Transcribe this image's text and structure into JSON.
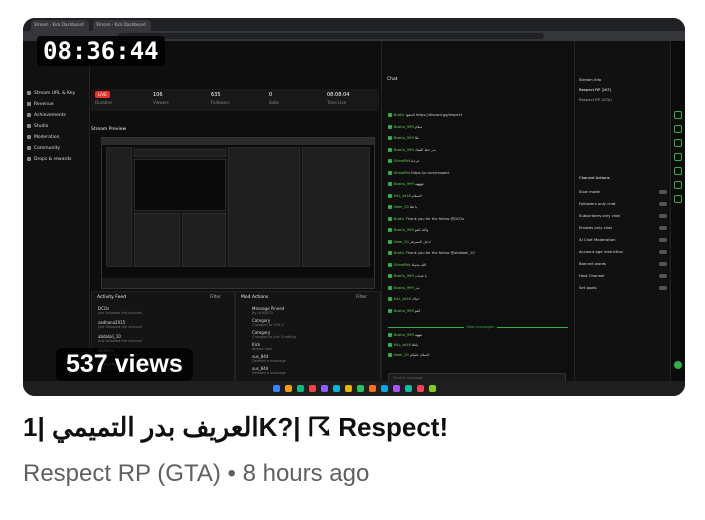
{
  "video": {
    "timestamp": "08:36:44",
    "views": "537 views",
    "title": "العريف بدر التميمي |1K?| ☈ Respect!",
    "channel": "Respect RP (GTA)",
    "separator": "•",
    "posted": "8 hours ago"
  },
  "dashboard": {
    "tabs": [
      "Stream - Kick Dashboard",
      "Stream - Kick Dashboard"
    ],
    "sidebar": [
      "Stream URL & Key",
      "Revenue",
      "Achievements",
      "Studio",
      "Moderation",
      "Community",
      "Drops & rewards"
    ],
    "stats": [
      {
        "value": "LIVE",
        "label": "Duration"
      },
      {
        "value": "106",
        "label": "Viewers"
      },
      {
        "value": "635",
        "label": "Followers"
      },
      {
        "value": "0",
        "label": "Subs"
      },
      {
        "value": "08:08:04",
        "label": "Time Live"
      }
    ],
    "preview_title": "Stream Preview",
    "activity_title": "Activity Feed",
    "activity_filter": "Filter",
    "activity": [
      {
        "name": "DCOs",
        "sub": "Just followed the channel"
      },
      {
        "name": "sadhana2015",
        "sub": "Just followed the channel"
      },
      {
        "name": "abdalali_10",
        "sub": "Just followed the channel"
      },
      {
        "name": "NAHAFs",
        "sub": "Just followed the channel"
      },
      {
        "name": "Al_Haafidi",
        "sub": "Just followed the channel"
      }
    ],
    "mod_title": "Mod Actions",
    "mod_filter": "Filter",
    "mod_actions": [
      {
        "name": "Message Pinned",
        "sub": "By ALNAJTD"
      },
      {
        "name": "Category",
        "sub": "Changed to GTA V"
      },
      {
        "name": "Category",
        "sub": "Changed to Just Chatting"
      },
      {
        "name": "Kick",
        "sub": "Kicked user"
      },
      {
        "name": "sus_844",
        "sub": "Deleted a message"
      },
      {
        "name": "sus_844",
        "sub": "Deleted a message"
      }
    ],
    "chat_title": "Chat",
    "chat": [
      {
        "name": "Buttic",
        "text": "الحقوا https://discord.gg/respect"
      },
      {
        "name": "Boshu_999",
        "text": "سلام"
      },
      {
        "name": "Boshu_999",
        "text": "هلا"
      },
      {
        "name": "Boshu_999",
        "text": "بدر حط اللينك"
      },
      {
        "name": "ShootPot",
        "text": "مرحبا"
      },
      {
        "name": "ShootPot",
        "text": "https://x.com/respect"
      },
      {
        "name": "Boshu_999",
        "text": "ههههه"
      },
      {
        "name": "NLL_bt16",
        "text": "السلام"
      },
      {
        "name": "Nam_20",
        "text": "يا هلا"
      },
      {
        "name": "Buttic",
        "text": "Thank you for the follow @DCOs"
      },
      {
        "name": "Boshu_999",
        "text": "والله كفو"
      },
      {
        "name": "Nam_20",
        "text": "ادخل السيرفر"
      },
      {
        "name": "Buttic",
        "text": "Thank you for the follow @abdalali_10"
      },
      {
        "name": "ShootPot",
        "text": "الله يحييك"
      },
      {
        "name": "Boshu_999",
        "text": "يا شباب"
      },
      {
        "name": "Boshu_999",
        "text": "بدر"
      },
      {
        "name": "NLL_bt16",
        "text": "حياك"
      },
      {
        "name": "Boshu_999",
        "text": "كفو"
      }
    ],
    "new_messages": "New messages",
    "after_new": [
      {
        "name": "Boshu_999",
        "text": "هههه"
      },
      {
        "name": "NLL_bt16",
        "text": "ياهلا"
      },
      {
        "name": "Nam_20",
        "text": "السلام عليكم"
      }
    ],
    "chat_placeholder": "Send a message",
    "chat_send": "Chat",
    "info_title": "Stream Info",
    "info_stream_title": "Respect RP |1K?|",
    "info_category": "Respect RP (GTA)",
    "channel_actions_title": "Channel Actions",
    "channel_actions": [
      "Slow mode",
      "Followers only chat",
      "Subscribers only chat",
      "Emotes only chat",
      "AI Chat Moderation",
      "Account age restriction",
      "Banned words",
      "Host Channel",
      "Set goals"
    ]
  },
  "colors": {
    "accent": "#2eb14a",
    "live": "#e5322d",
    "title": "#0f0f0f",
    "meta": "#606060"
  }
}
